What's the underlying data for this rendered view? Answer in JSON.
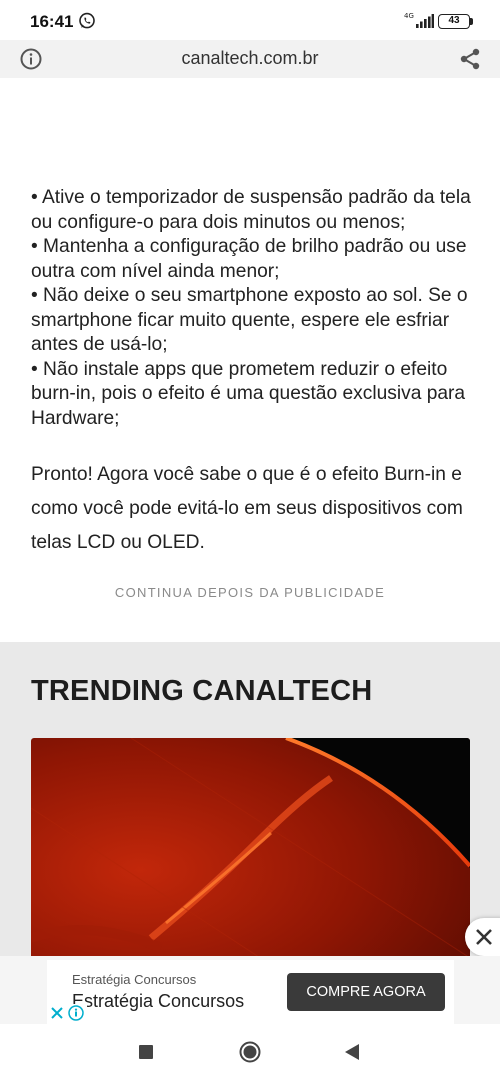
{
  "status_bar": {
    "time": "16:41",
    "network": "4G",
    "battery": "43"
  },
  "browser": {
    "url": "canaltech.com.br"
  },
  "article": {
    "bullets": [
      "•  Ative o temporizador de suspensão padrão da tela ou configure-o para dois minutos ou menos;",
      "•  Mantenha a configuração de brilho padrão ou use outra com nível ainda menor;",
      "•  Não deixe o seu smartphone exposto ao sol. Se o smartphone ficar muito quente, espere ele esfriar antes de usá-lo;",
      "•  Não instale apps que prometem reduzir o efeito burn-in, pois o efeito é uma questão exclusiva para Hardware;"
    ],
    "conclusion": "Pronto! Agora você sabe o que é o efeito Burn-in e como você pode evitá-lo em seus dispositivos com telas LCD ou OLED.",
    "ad_notice": "CONTINUA DEPOIS DA PUBLICIDADE"
  },
  "trending": {
    "title": "TRENDING CANALTECH"
  },
  "ad": {
    "advertiser": "Estratégia Concursos",
    "headline": "Estratégia Concursos",
    "cta": "COMPRE AGORA"
  },
  "icons": {
    "whatsapp": "whatsapp-icon",
    "signal": "signal-icon",
    "info": "info-icon",
    "share": "share-icon",
    "close": "close-icon",
    "adchoices": "adchoices-icon",
    "recents": "recents-icon",
    "home": "home-icon",
    "back": "back-icon"
  },
  "colors": {
    "ad_button": "#3a3a3a",
    "trending_bg": "#e9e9e9",
    "adchoices": "#00aecd"
  }
}
